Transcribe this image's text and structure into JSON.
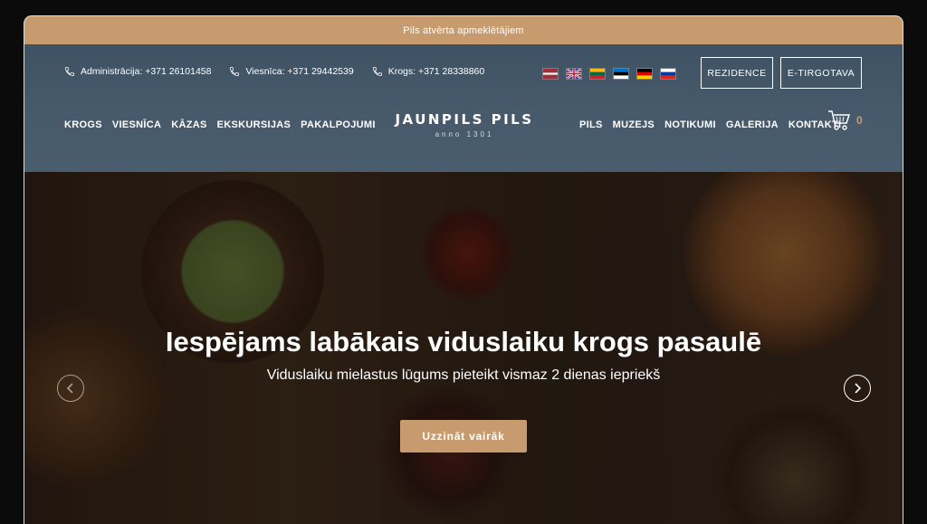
{
  "announcement": "Pils atvērta apmeklētājiem",
  "contacts": [
    {
      "label": "Administrācija: +371 26101458"
    },
    {
      "label": "Viesnīca: +371 29442539"
    },
    {
      "label": "Krogs: +371 28338860"
    }
  ],
  "languages": [
    "lv",
    "en",
    "lt",
    "et",
    "de",
    "ru"
  ],
  "header_buttons": {
    "residence": "REZIDENCE",
    "shop": "E-TIRGOTAVA"
  },
  "logo": {
    "main": "JAUNPILS PILS",
    "sub": "anno 1301"
  },
  "nav_left": [
    "KROGS",
    "VIESNĪCA",
    "KĀZAS",
    "EKSKURSIJAS",
    "PAKALPOJUMI"
  ],
  "nav_right": [
    "PILS",
    "MUZEJS",
    "NOTIKUMI",
    "GALERIJA",
    "KONTAKTI"
  ],
  "cart": {
    "count": "0"
  },
  "hero": {
    "title": "Iespējams labākais viduslaiku krogs pasaulē",
    "subtitle": "Viduslaiku mielastus lūgums pieteikt vismaz 2 dienas iepriekš",
    "cta": "Uzzināt vairāk"
  },
  "colors": {
    "accent": "#c79b6d",
    "header_bg": "#475a6c"
  }
}
